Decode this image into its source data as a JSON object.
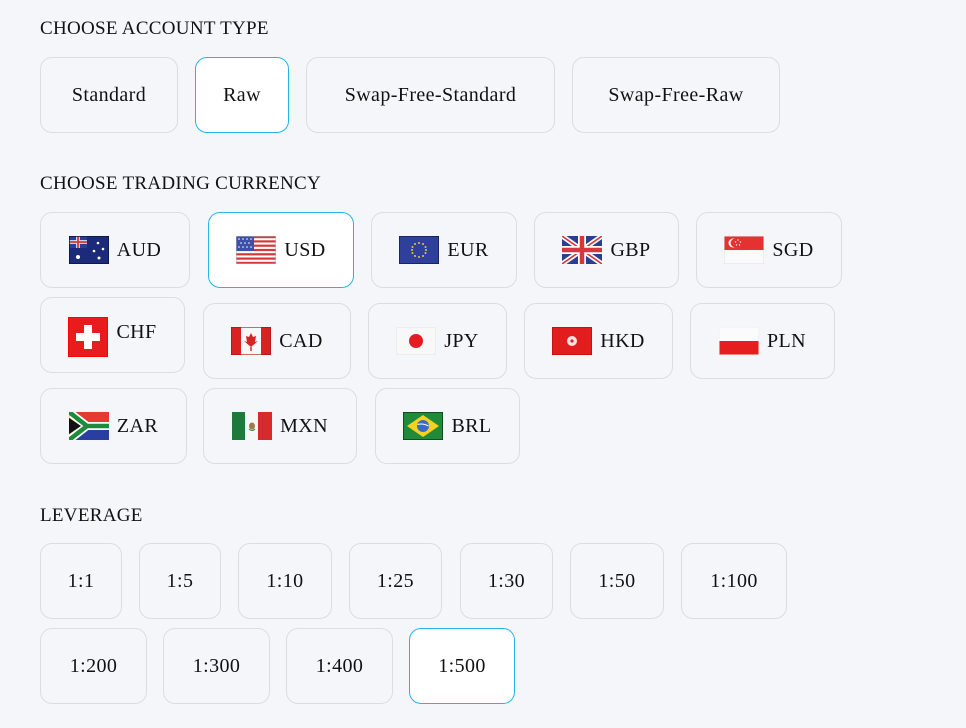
{
  "account_type": {
    "title": "CHOOSE ACCOUNT TYPE",
    "options": [
      {
        "label": "Standard",
        "selected": false
      },
      {
        "label": "Raw",
        "selected": true
      },
      {
        "label": "Swap-Free-Standard",
        "selected": false
      },
      {
        "label": "Swap-Free-Raw",
        "selected": false
      }
    ]
  },
  "currency": {
    "title": "CHOOSE TRADING CURRENCY",
    "options": [
      {
        "code": "AUD",
        "flag": "australia-flag",
        "selected": false
      },
      {
        "code": "USD",
        "flag": "usa-flag",
        "selected": true
      },
      {
        "code": "EUR",
        "flag": "eu-flag",
        "selected": false
      },
      {
        "code": "GBP",
        "flag": "uk-flag",
        "selected": false
      },
      {
        "code": "SGD",
        "flag": "singapore-flag",
        "selected": false
      },
      {
        "code": "CHF",
        "flag": "switzerland-flag",
        "selected": false
      },
      {
        "code": "CAD",
        "flag": "canada-flag",
        "selected": false
      },
      {
        "code": "JPY",
        "flag": "japan-flag",
        "selected": false
      },
      {
        "code": "HKD",
        "flag": "hong-kong-flag",
        "selected": false
      },
      {
        "code": "PLN",
        "flag": "poland-flag",
        "selected": false
      },
      {
        "code": "ZAR",
        "flag": "south-africa-flag",
        "selected": false
      },
      {
        "code": "MXN",
        "flag": "mexico-flag",
        "selected": false
      },
      {
        "code": "BRL",
        "flag": "brazil-flag",
        "selected": false
      }
    ]
  },
  "leverage": {
    "title": "LEVERAGE",
    "options": [
      {
        "label": "1:1",
        "selected": false
      },
      {
        "label": "1:5",
        "selected": false
      },
      {
        "label": "1:10",
        "selected": false
      },
      {
        "label": "1:25",
        "selected": false
      },
      {
        "label": "1:30",
        "selected": false
      },
      {
        "label": "1:50",
        "selected": false
      },
      {
        "label": "1:100",
        "selected": false
      },
      {
        "label": "1:200",
        "selected": false
      },
      {
        "label": "1:300",
        "selected": false
      },
      {
        "label": "1:400",
        "selected": false
      },
      {
        "label": "1:500",
        "selected": true
      }
    ]
  },
  "colors": {
    "selected_border": "#27b3ea",
    "default_border": "#dcdde2",
    "background": "#f5f6fa"
  }
}
